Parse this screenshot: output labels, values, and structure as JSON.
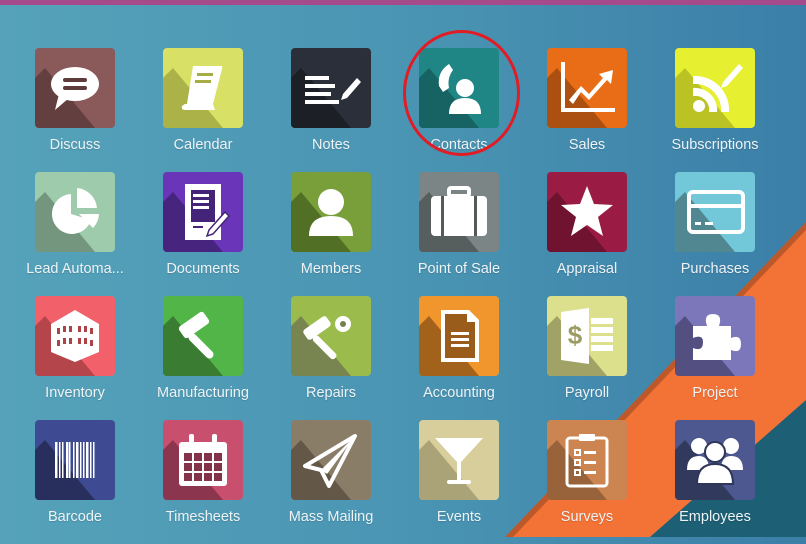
{
  "header": {
    "bar_color": "#a54a8a"
  },
  "background": {
    "base_color": "#4a95b3",
    "band_orange": "#f37236",
    "band_teal": "#1d5f74"
  },
  "annotation": {
    "type": "circle-highlight",
    "target": "Contacts",
    "color": "#e21c24"
  },
  "apps": [
    {
      "label": "Discuss",
      "icon": "speech-bubble-icon",
      "color": "#8a5a5a",
      "shadow": "#5e3c3c"
    },
    {
      "label": "Calendar",
      "icon": "book-icon",
      "color": "#d8e065",
      "shadow": "#a6ad45"
    },
    {
      "label": "Notes",
      "icon": "notepad-pencil-icon",
      "color": "#2b2f3a",
      "shadow": "#1b1e25"
    },
    {
      "label": "Contacts",
      "icon": "phone-person-icon",
      "color": "#1f8585",
      "shadow": "#165e5e"
    },
    {
      "label": "Sales",
      "icon": "trend-chart-icon",
      "color": "#e96d16",
      "shadow": "#a44c0f"
    },
    {
      "label": "Subscriptions",
      "icon": "rss-pencil-icon",
      "color": "#e6ef30",
      "shadow": "#b5bd23"
    },
    {
      "label": "Lead Automa...",
      "icon": "pie-chart-icon",
      "color": "#9ecbac",
      "shadow": "#6f8f79"
    },
    {
      "label": "Documents",
      "icon": "document-pencil-icon",
      "color": "#6a35b8",
      "shadow": "#442478"
    },
    {
      "label": "Members",
      "icon": "person-icon",
      "color": "#789f3a",
      "shadow": "#4d6a24"
    },
    {
      "label": "Point of Sale",
      "icon": "briefcase-icon",
      "color": "#7b8585",
      "shadow": "#525a5a"
    },
    {
      "label": "Appraisal",
      "icon": "star-icon",
      "color": "#9a1c44",
      "shadow": "#6c1330"
    },
    {
      "label": "Purchases",
      "icon": "credit-card-icon",
      "color": "#72c8d8",
      "shadow": "#4e8088"
    },
    {
      "label": "Inventory",
      "icon": "warehouse-icon",
      "color": "#f2606a",
      "shadow": "#ad4247"
    },
    {
      "label": "Manufacturing",
      "icon": "hammer-icon",
      "color": "#52b548",
      "shadow": "#37762f"
    },
    {
      "label": "Repairs",
      "icon": "hammer-gear-icon",
      "color": "#9bbb4c",
      "shadow": "#748051"
    },
    {
      "label": "Accounting",
      "icon": "invoice-icon",
      "color": "#f1962d",
      "shadow": "#9a5c1b"
    },
    {
      "label": "Payroll",
      "icon": "payslip-icon",
      "color": "#dce08d",
      "shadow": "#9a9c62"
    },
    {
      "label": "Project",
      "icon": "puzzle-icon",
      "color": "#7c77bb",
      "shadow": "#4f4a7a"
    },
    {
      "label": "Barcode",
      "icon": "barcode-icon",
      "color": "#3e4a92",
      "shadow": "#262c57"
    },
    {
      "label": "Timesheets",
      "icon": "calendar-grid-icon",
      "color": "#c94f6e",
      "shadow": "#84334a"
    },
    {
      "label": "Mass Mailing",
      "icon": "paper-plane-icon",
      "color": "#8a7d67",
      "shadow": "#5e5445"
    },
    {
      "label": "Events",
      "icon": "cocktail-glass-icon",
      "color": "#d8ce9b",
      "shadow": "#a69e74"
    },
    {
      "label": "Surveys",
      "icon": "clipboard-checklist-icon",
      "color": "#cc8550",
      "shadow": "#925f37"
    },
    {
      "label": "Employees",
      "icon": "group-people-icon",
      "color": "#4d5790",
      "shadow": "#2f3658"
    }
  ]
}
